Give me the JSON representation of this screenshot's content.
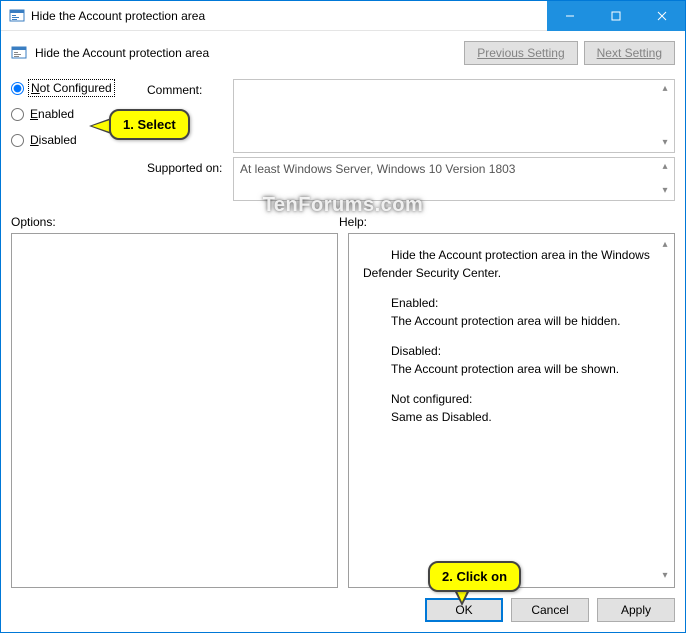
{
  "title": "Hide the Account protection area",
  "header_title": "Hide the Account protection area",
  "nav": {
    "prev": "Previous Setting",
    "next": "Next Setting"
  },
  "radios": {
    "not_configured": "Not Configured",
    "enabled": "Enabled",
    "disabled": "Disabled"
  },
  "labels": {
    "comment": "Comment:",
    "supported": "Supported on:",
    "options": "Options:",
    "help": "Help:"
  },
  "supported_text": "At least Windows Server, Windows 10 Version 1803",
  "help": {
    "intro": "Hide the Account protection area in the Windows Defender Security Center.",
    "enabled_h": "Enabled:",
    "enabled_t": "The Account protection area will be hidden.",
    "disabled_h": "Disabled:",
    "disabled_t": "The Account protection area will be shown.",
    "nc_h": "Not configured:",
    "nc_t": "Same as Disabled."
  },
  "buttons": {
    "ok": "OK",
    "cancel": "Cancel",
    "apply": "Apply"
  },
  "callouts": {
    "c1": "1. Select",
    "c2": "2. Click on"
  },
  "watermark": "TenForums.com"
}
